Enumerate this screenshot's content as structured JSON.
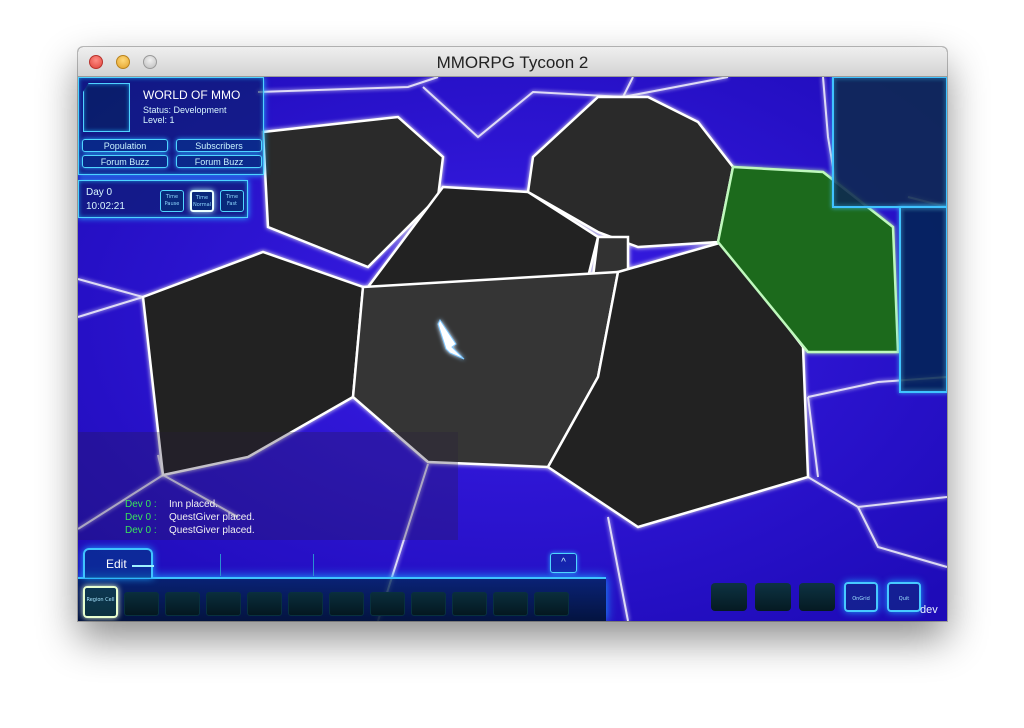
{
  "window": {
    "title": "MMORPG Tycoon 2"
  },
  "world": {
    "name": "WORLD OF MMO",
    "status": "Status: Development",
    "level": "Level: 1",
    "buttons": [
      "Population",
      "Subscribers",
      "Forum Buzz",
      "Forum Buzz"
    ]
  },
  "time": {
    "day": "Day 0",
    "clock": "10:02:21",
    "buttons": [
      "Time Pause",
      "Time Normal",
      "Time Fast"
    ]
  },
  "log": [
    {
      "day": "Dev 0 :",
      "message": "Inn placed."
    },
    {
      "day": "Dev 0 :",
      "message": "QuestGiver placed."
    },
    {
      "day": "Dev 0 :",
      "message": "QuestGiver placed."
    }
  ],
  "toolbar": {
    "edit_label": "Edit",
    "collapse_label": "^",
    "first_slot_label": "Region Cell",
    "empty_slot_count": 11
  },
  "right_panel": {
    "buttons": [
      "OnGrid",
      "Quit"
    ],
    "mode_label": "dev"
  },
  "colors": {
    "background": "#2a0fd9",
    "region_fill": "#262626",
    "selected_region": "#1f6b1c",
    "hud_accent": "#4fd6ff",
    "log_day": "#39e45c"
  }
}
